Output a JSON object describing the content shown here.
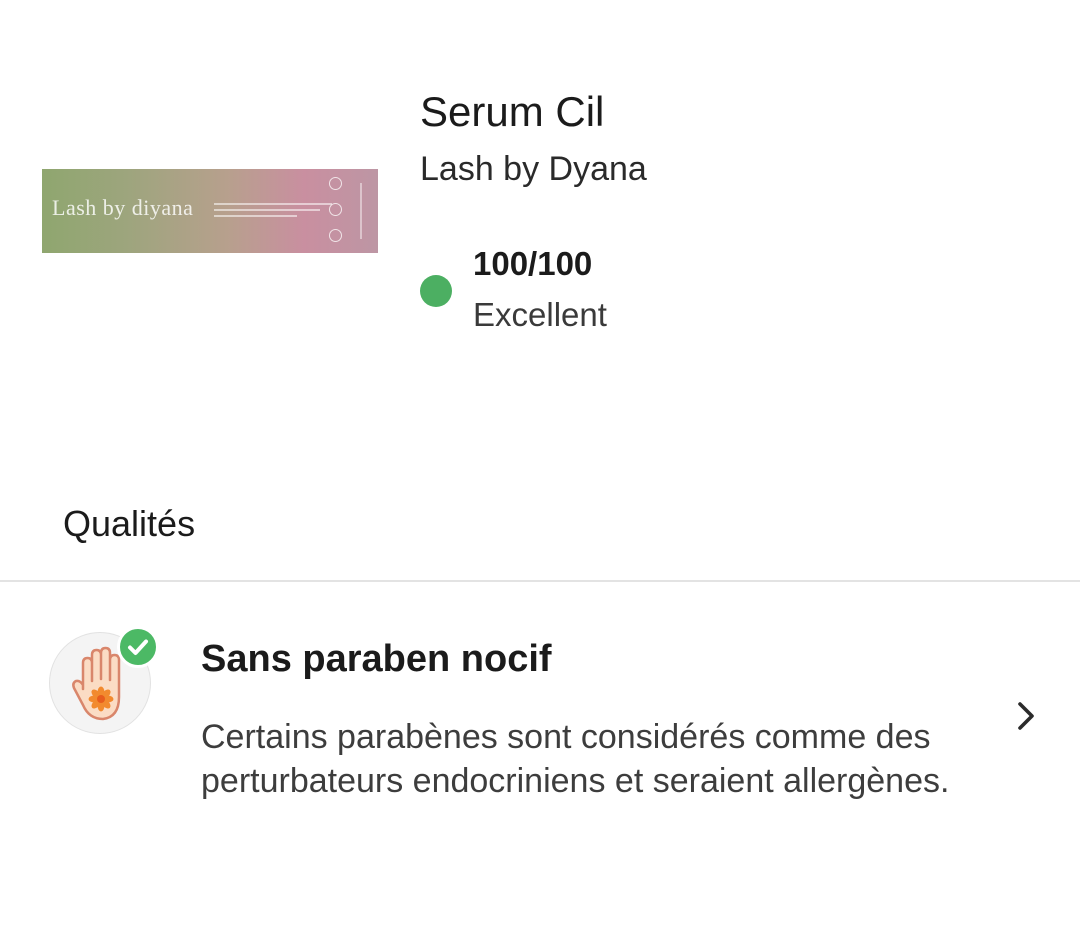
{
  "product": {
    "image_text": "Lash by diyana",
    "title": "Serum Cil",
    "brand": "Lash by Dyana",
    "score": "100/100",
    "rating": "Excellent",
    "rating_color": "#4caf62"
  },
  "qualities": {
    "heading": "Qualités",
    "items": [
      {
        "icon": "hand-flower-icon",
        "status_icon": "check-icon",
        "title": "Sans paraben nocif",
        "description": "Certains parabènes sont considérés comme des perturbateurs endocriniens et seraient allergènes."
      }
    ]
  },
  "colors": {
    "accent_green": "#4cb965",
    "divider": "#e3e3e3"
  }
}
